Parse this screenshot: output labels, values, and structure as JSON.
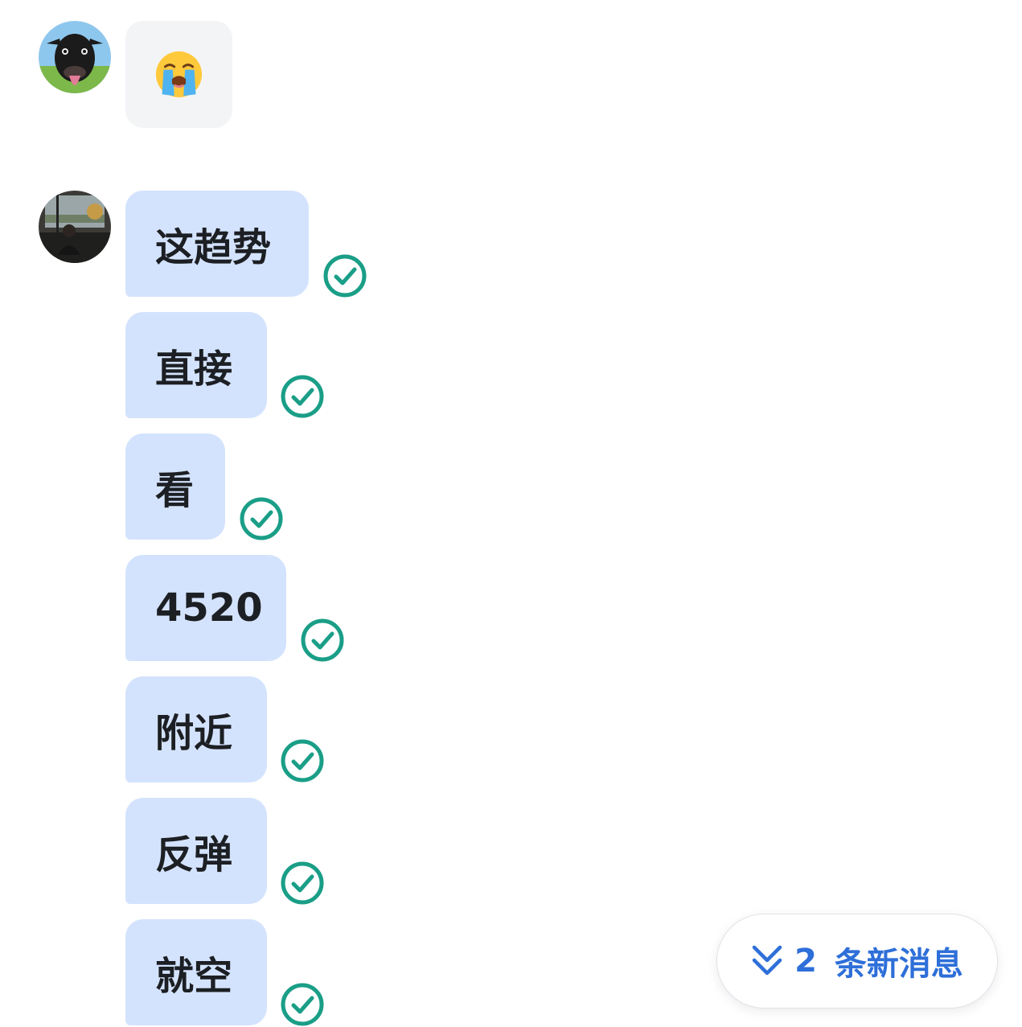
{
  "conversation": {
    "incoming": {
      "avatar_icon": "cow-avatar-icon",
      "emoji_icon": "loudly-crying-face-emoji"
    },
    "outgoing": {
      "avatar_icon": "person-avatar-icon",
      "messages": [
        {
          "text": "这趋势",
          "status": "read-check-icon"
        },
        {
          "text": "直接",
          "status": "read-check-icon"
        },
        {
          "text": "看",
          "status": "read-check-icon"
        },
        {
          "text": "4520",
          "status": "read-check-icon"
        },
        {
          "text": "附近",
          "status": "read-check-icon"
        },
        {
          "text": "反弹",
          "status": "read-check-icon"
        },
        {
          "text": "就空",
          "status": "read-check-icon"
        }
      ]
    }
  },
  "new_messages": {
    "count": "2",
    "label": "条新消息",
    "icon": "double-chevron-down-icon"
  },
  "colors": {
    "outgoing_bubble": "#d4e3fd",
    "incoming_bubble": "#f3f4f6",
    "check": "#1a9e87",
    "accent": "#2e6fd9"
  }
}
